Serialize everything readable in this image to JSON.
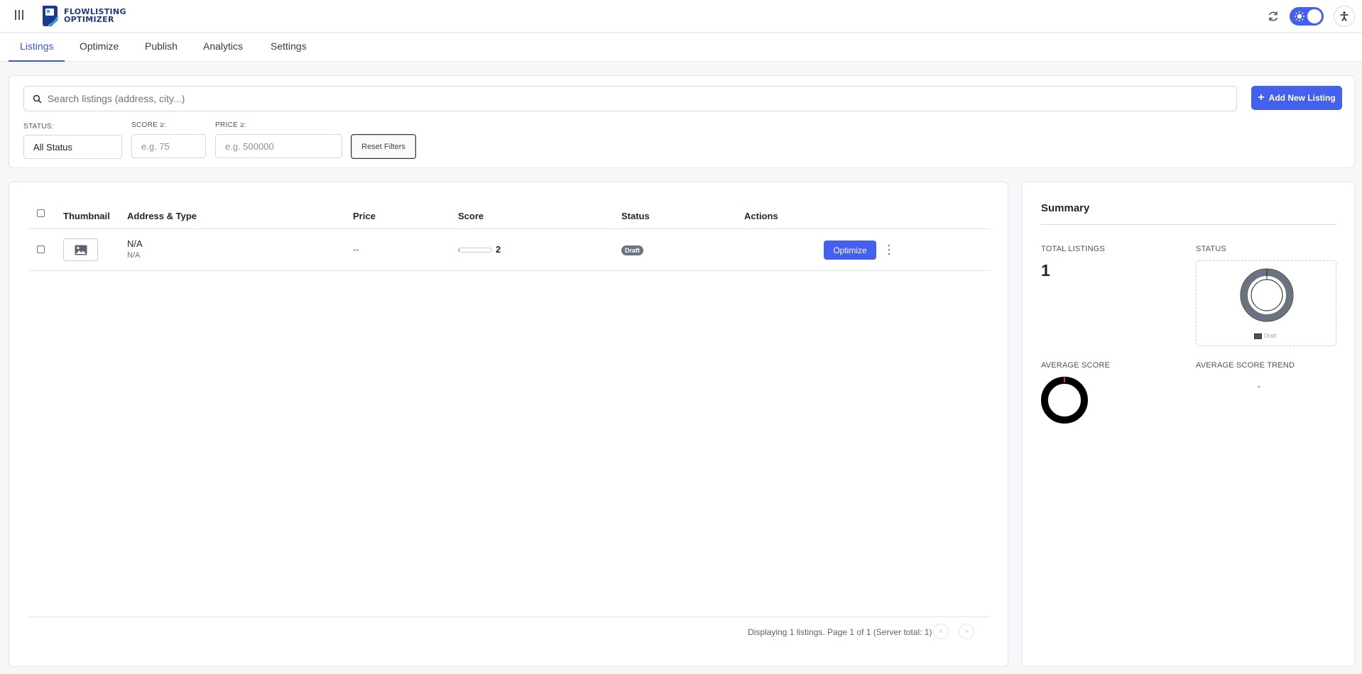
{
  "app": {
    "logo_line1": "FLOWLISTING",
    "logo_line2": "OPTIMIZER"
  },
  "tabs": [
    {
      "label": "Listings",
      "active": true
    },
    {
      "label": "Optimize",
      "active": false
    },
    {
      "label": "Publish",
      "active": false
    },
    {
      "label": "Analytics",
      "active": false
    },
    {
      "label": "Settings",
      "active": false
    }
  ],
  "filters": {
    "search_placeholder": "Search listings (address, city...)",
    "add_button": "Add New Listing",
    "status_label": "STATUS:",
    "status_value": "All Status",
    "score_label": "SCORE ≥:",
    "score_placeholder": "e.g. 75",
    "price_label": "PRICE ≥:",
    "price_placeholder": "e.g. 500000",
    "reset_button": "Reset Filters"
  },
  "table": {
    "headers": [
      "Thumbnail",
      "Address & Type",
      "Price",
      "Score",
      "Status",
      "Actions"
    ],
    "rows": [
      {
        "address": "N/A",
        "type": "N/A",
        "price": "--",
        "score": "2",
        "score_fraction": 0.02,
        "status": "Draft",
        "action": "Optimize"
      }
    ],
    "pager_text": "Displaying 1 listings. Page 1 of 1 (Server total: 1)",
    "prev": "‹",
    "next": "›"
  },
  "summary": {
    "title": "Summary",
    "total_label": "TOTAL LISTINGS",
    "total_value": "1",
    "status_label": "STATUS",
    "status_legend": "Draft",
    "avg_label": "AVERAGE SCORE",
    "trend_label": "AVERAGE SCORE TREND",
    "trend_value": "-"
  },
  "colors": {
    "accent": "#4361ee",
    "draft": "#6b7280",
    "score_mark": "#e0245e"
  }
}
